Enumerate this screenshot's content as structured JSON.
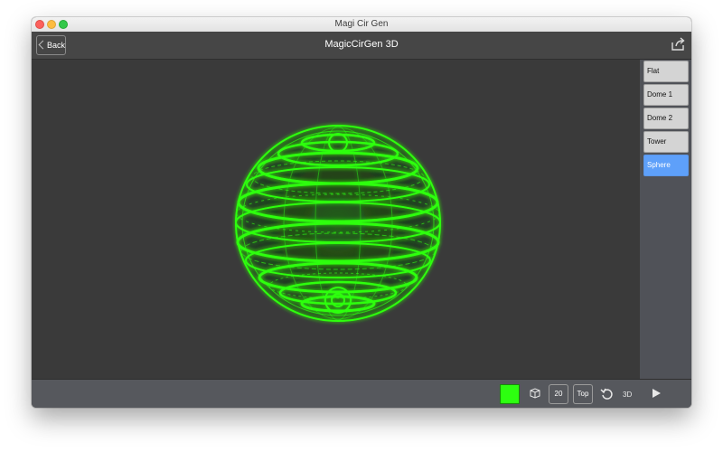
{
  "window": {
    "title": "Magi Cir Gen"
  },
  "navbar": {
    "back_label": "Back",
    "title": "MagicCirGen 3D"
  },
  "sidebar": {
    "items": [
      {
        "label": "Flat",
        "selected": false
      },
      {
        "label": "Dome 1",
        "selected": false
      },
      {
        "label": "Dome 2",
        "selected": false
      },
      {
        "label": "Tower",
        "selected": false
      },
      {
        "label": "Sphere",
        "selected": true
      }
    ]
  },
  "toolbar": {
    "color": "#2dff10",
    "count_label": "20",
    "view_label": "Top",
    "mode_label": "3D",
    "icons": [
      "cube-icon",
      "undo-icon",
      "play-icon"
    ]
  },
  "colors": {
    "accent": "#5ea0fa",
    "glow": "#2dff10",
    "viewport": "#3a3a3a"
  }
}
